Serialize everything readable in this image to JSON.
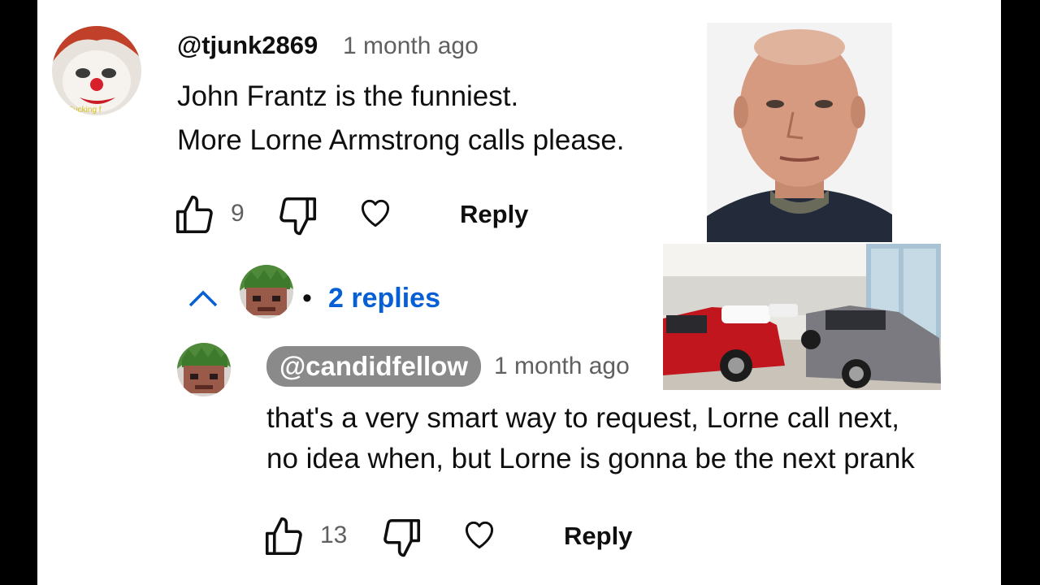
{
  "comment": {
    "author": "@tjunk2869",
    "time": "1 month ago",
    "lines": [
      "John Frantz is the funniest.",
      "More Lorne Armstrong calls please."
    ],
    "likes": "9",
    "reply_label": "Reply",
    "avatar_caption": "Fucking f",
    "avatar_icon": "clown-face-avatar"
  },
  "replies_toggle": {
    "label": "2 replies",
    "separator": "•",
    "icon": "chevron-up-icon"
  },
  "reply": {
    "author": "@candidfellow",
    "time": "1 month ago",
    "lines": [
      "that's a very smart way to request, Lorne call next,",
      "no idea when, but Lorne is gonna be the next prank"
    ],
    "likes": "13",
    "reply_label": "Reply",
    "avatar_icon": "pixel-face-avatar"
  },
  "overlays": {
    "portrait_icon": "man-portrait-photo",
    "showroom_icon": "car-dealership-showroom-photo"
  },
  "colors": {
    "link_blue": "#065fd4",
    "muted_text": "#606060",
    "chip_gray": "#8a8a8a"
  }
}
